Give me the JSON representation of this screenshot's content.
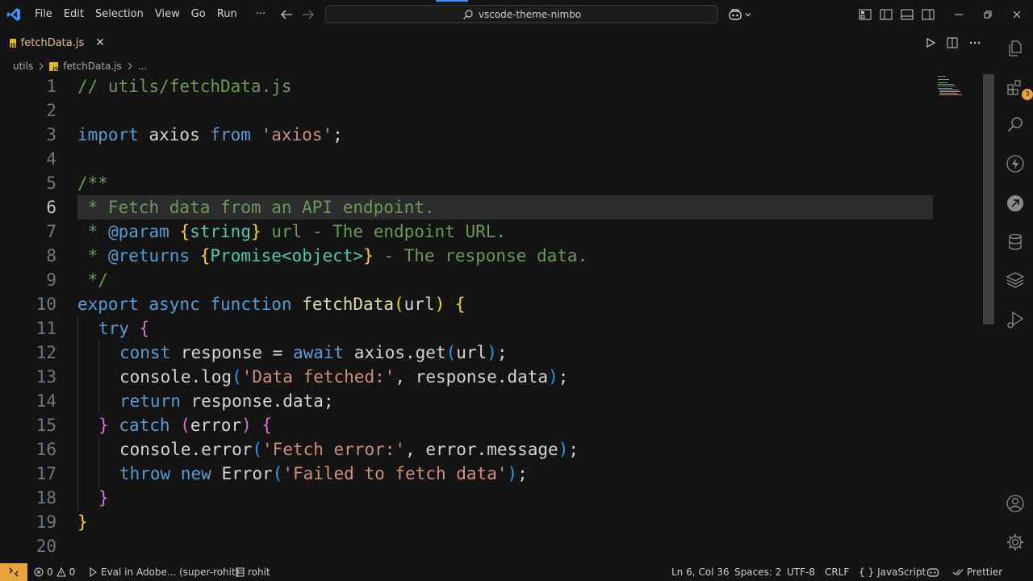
{
  "menu": [
    "File",
    "Edit",
    "Selection",
    "View",
    "Go",
    "Run",
    "···"
  ],
  "command_center": "vscode-theme-nimbo",
  "tab": {
    "label": "fetchData.js",
    "close": "✕"
  },
  "breadcrumbs": {
    "folder": "utils",
    "file": "fetchData.js",
    "more": "..."
  },
  "editor": {
    "current_line": 6,
    "line_numbers": [
      "1",
      "2",
      "3",
      "4",
      "5",
      "6",
      "7",
      "8",
      "9",
      "10",
      "11",
      "12",
      "13",
      "14",
      "15",
      "16",
      "17",
      "18",
      "19",
      "20"
    ],
    "lines": [
      {
        "indent": 0,
        "tokens": [
          {
            "t": "// utils/fetchData.js",
            "c": "cm"
          }
        ]
      },
      {
        "indent": 0,
        "tokens": []
      },
      {
        "indent": 0,
        "tokens": [
          {
            "t": "import",
            "c": "kw"
          },
          {
            "t": " axios ",
            "c": "pl"
          },
          {
            "t": "from",
            "c": "kw"
          },
          {
            "t": " ",
            "c": "pl"
          },
          {
            "t": "'axios'",
            "c": "str"
          },
          {
            "t": ";",
            "c": "pl"
          }
        ]
      },
      {
        "indent": 0,
        "tokens": []
      },
      {
        "indent": 0,
        "tokens": [
          {
            "t": "/**",
            "c": "cm"
          }
        ]
      },
      {
        "indent": 0,
        "tokens": [
          {
            "t": " * Fetch data from an API endpoint.",
            "c": "cm"
          }
        ]
      },
      {
        "indent": 0,
        "tokens": [
          {
            "t": " * ",
            "c": "cm"
          },
          {
            "t": "@param",
            "c": "tag"
          },
          {
            "t": " ",
            "c": "cm"
          },
          {
            "t": "{",
            "c": "br1"
          },
          {
            "t": "string",
            "c": "typ"
          },
          {
            "t": "}",
            "c": "br1"
          },
          {
            "t": " url - The endpoint URL.",
            "c": "cm"
          }
        ]
      },
      {
        "indent": 0,
        "tokens": [
          {
            "t": " * ",
            "c": "cm"
          },
          {
            "t": "@returns",
            "c": "tag"
          },
          {
            "t": " ",
            "c": "cm"
          },
          {
            "t": "{",
            "c": "br1"
          },
          {
            "t": "Promise<object>",
            "c": "typ"
          },
          {
            "t": "}",
            "c": "br1"
          },
          {
            "t": " - The response data.",
            "c": "cm"
          }
        ]
      },
      {
        "indent": 0,
        "tokens": [
          {
            "t": " */",
            "c": "cm"
          }
        ]
      },
      {
        "indent": 0,
        "tokens": [
          {
            "t": "export",
            "c": "kw"
          },
          {
            "t": " ",
            "c": "pl"
          },
          {
            "t": "async",
            "c": "kw"
          },
          {
            "t": " ",
            "c": "pl"
          },
          {
            "t": "function",
            "c": "kw"
          },
          {
            "t": " ",
            "c": "pl"
          },
          {
            "t": "fetchData",
            "c": "fn"
          },
          {
            "t": "(",
            "c": "br1"
          },
          {
            "t": "url",
            "c": "pl"
          },
          {
            "t": ")",
            "c": "br1"
          },
          {
            "t": " ",
            "c": "pl"
          },
          {
            "t": "{",
            "c": "br1"
          }
        ]
      },
      {
        "indent": 1,
        "tokens": [
          {
            "t": "try",
            "c": "kw"
          },
          {
            "t": " ",
            "c": "pl"
          },
          {
            "t": "{",
            "c": "br2"
          }
        ]
      },
      {
        "indent": 2,
        "tokens": [
          {
            "t": "const",
            "c": "kw"
          },
          {
            "t": " response = ",
            "c": "pl"
          },
          {
            "t": "await",
            "c": "kw"
          },
          {
            "t": " axios.get",
            "c": "pl"
          },
          {
            "t": "(",
            "c": "br3"
          },
          {
            "t": "url",
            "c": "pl"
          },
          {
            "t": ")",
            "c": "br3"
          },
          {
            "t": ";",
            "c": "pl"
          }
        ]
      },
      {
        "indent": 2,
        "tokens": [
          {
            "t": "console.log",
            "c": "pl"
          },
          {
            "t": "(",
            "c": "br3"
          },
          {
            "t": "'Data fetched:'",
            "c": "str"
          },
          {
            "t": ", response.data",
            "c": "pl"
          },
          {
            "t": ")",
            "c": "br3"
          },
          {
            "t": ";",
            "c": "pl"
          }
        ]
      },
      {
        "indent": 2,
        "tokens": [
          {
            "t": "return",
            "c": "kw"
          },
          {
            "t": " response.data;",
            "c": "pl"
          }
        ]
      },
      {
        "indent": 1,
        "tokens": [
          {
            "t": "}",
            "c": "br2"
          },
          {
            "t": " ",
            "c": "pl"
          },
          {
            "t": "catch",
            "c": "kw"
          },
          {
            "t": " ",
            "c": "pl"
          },
          {
            "t": "(",
            "c": "br2"
          },
          {
            "t": "error",
            "c": "pl"
          },
          {
            "t": ")",
            "c": "br2"
          },
          {
            "t": " ",
            "c": "pl"
          },
          {
            "t": "{",
            "c": "br2"
          }
        ]
      },
      {
        "indent": 2,
        "tokens": [
          {
            "t": "console.error",
            "c": "pl"
          },
          {
            "t": "(",
            "c": "br3"
          },
          {
            "t": "'Fetch error:'",
            "c": "str"
          },
          {
            "t": ", error.message",
            "c": "pl"
          },
          {
            "t": ")",
            "c": "br3"
          },
          {
            "t": ";",
            "c": "pl"
          }
        ]
      },
      {
        "indent": 2,
        "tokens": [
          {
            "t": "throw",
            "c": "kw"
          },
          {
            "t": " ",
            "c": "pl"
          },
          {
            "t": "new",
            "c": "kw"
          },
          {
            "t": " Error",
            "c": "pl"
          },
          {
            "t": "(",
            "c": "br3"
          },
          {
            "t": "'Failed to fetch data'",
            "c": "str"
          },
          {
            "t": ")",
            "c": "br3"
          },
          {
            "t": ";",
            "c": "pl"
          }
        ]
      },
      {
        "indent": 1,
        "tokens": [
          {
            "t": "}",
            "c": "br2"
          }
        ]
      },
      {
        "indent": 0,
        "tokens": [
          {
            "t": "}",
            "c": "br1"
          }
        ]
      },
      {
        "indent": 0,
        "tokens": []
      }
    ]
  },
  "activity_bar": {
    "extensions_badge": "3"
  },
  "statusbar": {
    "errors": "0",
    "warnings": "0",
    "eval": "Eval in Adobe...",
    "branch": "(super-rohit)",
    "user": "rohit",
    "cursor": "Ln 6, Col 36",
    "spaces": "Spaces: 2",
    "encoding": "UTF-8",
    "eol": "CRLF",
    "language": "JavaScript",
    "language_icon": "{ }",
    "formatter": "Prettier"
  },
  "colors": {
    "background": "#141414",
    "accent": "#e8a33d",
    "js_badge": "#e8b90b",
    "tab_label": "#e2c08d",
    "current_line_bg": "#2c2c2c"
  }
}
